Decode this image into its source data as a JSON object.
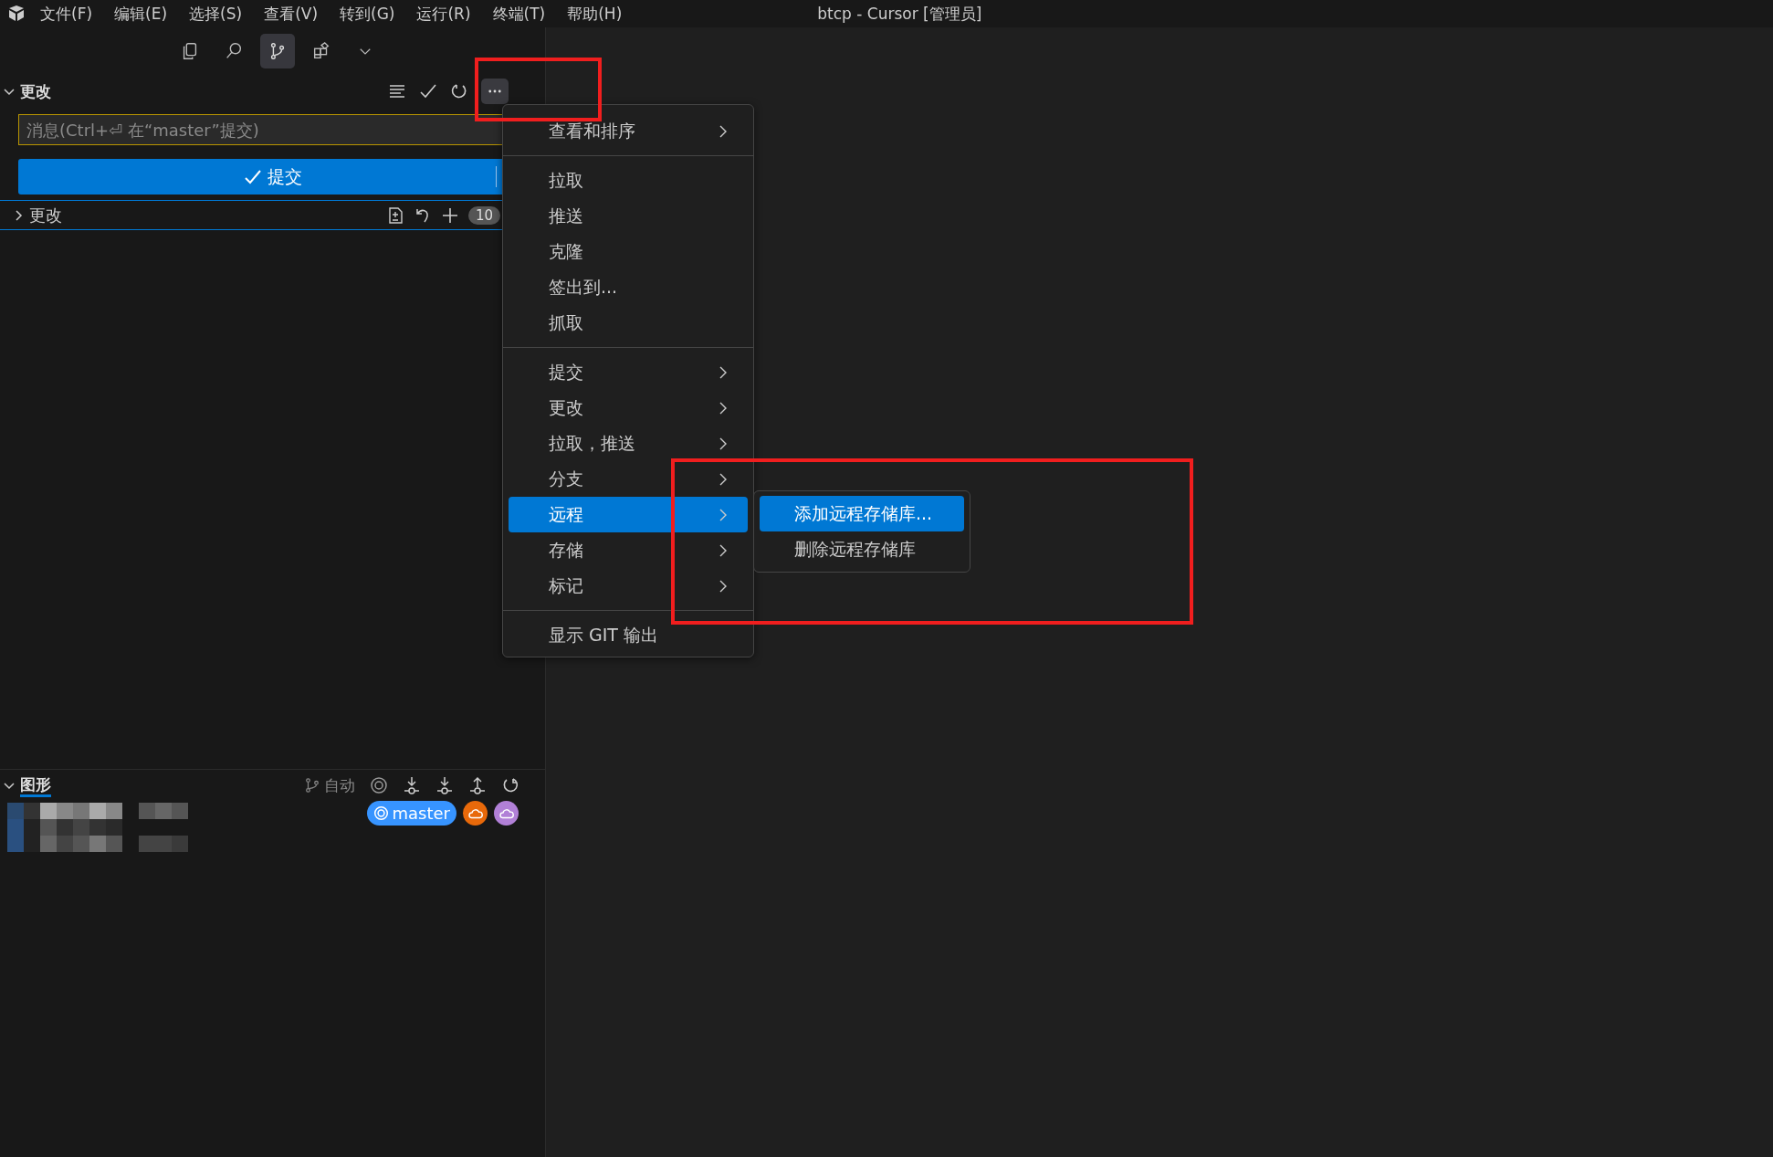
{
  "window": {
    "title": "btcp - Cursor [管理员]"
  },
  "menu_bar": [
    "文件(F)",
    "编辑(E)",
    "选择(S)",
    "查看(V)",
    "转到(G)",
    "运行(R)",
    "终端(T)",
    "帮助(H)"
  ],
  "activity_tabs": [
    {
      "kind": "files",
      "selected": false
    },
    {
      "kind": "search",
      "selected": false
    },
    {
      "kind": "source-control",
      "selected": true
    },
    {
      "kind": "extensions",
      "selected": false
    },
    {
      "kind": "more",
      "selected": false
    }
  ],
  "changes_section": {
    "title": "更改",
    "expanded": true,
    "message_placeholder": "消息(Ctrl+⏎ 在“master”提交)",
    "commit_button": "提交",
    "group": {
      "label": "更改",
      "expanded": false,
      "count": "10"
    }
  },
  "context_menu": {
    "groups": [
      [
        {
          "label": "查看和排序",
          "submenu": true,
          "selected": false
        }
      ],
      [
        {
          "label": "拉取",
          "submenu": false,
          "selected": false
        },
        {
          "label": "推送",
          "submenu": false,
          "selected": false
        },
        {
          "label": "克隆",
          "submenu": false,
          "selected": false
        },
        {
          "label": "签出到...",
          "submenu": false,
          "selected": false
        },
        {
          "label": "抓取",
          "submenu": false,
          "selected": false
        }
      ],
      [
        {
          "label": "提交",
          "submenu": true,
          "selected": false
        },
        {
          "label": "更改",
          "submenu": true,
          "selected": false
        },
        {
          "label": "拉取，推送",
          "submenu": true,
          "selected": false
        },
        {
          "label": "分支",
          "submenu": true,
          "selected": false
        },
        {
          "label": "远程",
          "submenu": true,
          "selected": true
        },
        {
          "label": "存储",
          "submenu": true,
          "selected": false
        },
        {
          "label": "标记",
          "submenu": true,
          "selected": false
        }
      ],
      [
        {
          "label": "显示 GIT 输出",
          "submenu": false,
          "selected": false
        }
      ]
    ]
  },
  "submenu": {
    "items": [
      {
        "label": "添加远程存储库...",
        "selected": true
      },
      {
        "label": "删除远程存储库",
        "selected": false
      }
    ]
  },
  "graph_section": {
    "title": "图形",
    "expanded": true,
    "auto_label": "自动",
    "refs": [
      {
        "kind": "branch",
        "label": "master",
        "color": "#3794ff"
      },
      {
        "kind": "remote",
        "color": "#e8690a"
      },
      {
        "kind": "remote",
        "color": "#b180d7"
      }
    ]
  }
}
